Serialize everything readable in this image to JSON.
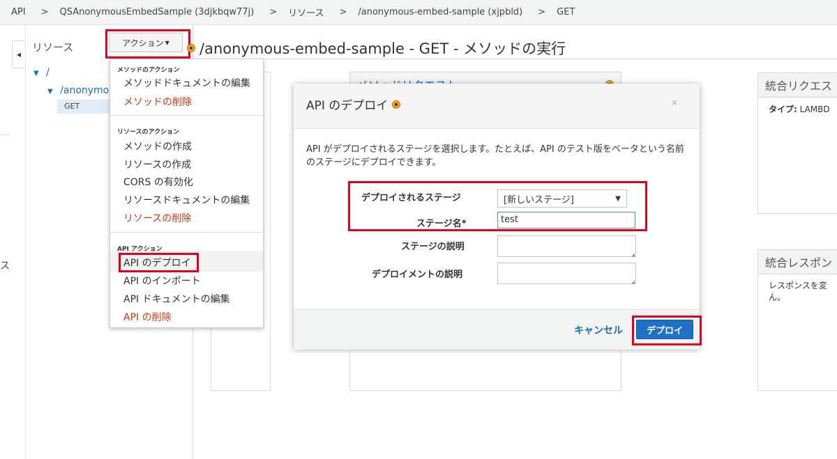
{
  "breadcrumb": [
    "API",
    "QSAnonymousEmbedSample (3djkbqw77j)",
    "リソース",
    "/anonymous-embed-sample (xjpbld)",
    "GET"
  ],
  "breadcrumb_separator": ">",
  "resources": {
    "title": "リソース",
    "actions_button": "アクション",
    "tree": {
      "root": "/",
      "child": "/anonymou",
      "method": "GET"
    }
  },
  "page_title": "/anonymous-embed-sample - GET - メソッドの実行",
  "left_strip_char": "ス",
  "background": {
    "method_request_title": "メソッドリクエスト",
    "integration_request_title": "統合リクエス",
    "integration_request_type_label": "タイプ:",
    "integration_request_type_value": "LAMBD",
    "integration_response_title": "統合レスポン",
    "integration_response_text": "レスポンスを変ん。"
  },
  "menu": {
    "sections": [
      {
        "header": "メソッドのアクション",
        "items": [
          {
            "label": "メソッドドキュメントの編集",
            "danger": false
          },
          {
            "label": "メソッドの削除",
            "danger": true
          }
        ]
      },
      {
        "header": "リソースのアクション",
        "items": [
          {
            "label": "メソッドの作成",
            "danger": false
          },
          {
            "label": "リソースの作成",
            "danger": false
          },
          {
            "label": "CORS の有効化",
            "danger": false
          },
          {
            "label": "リソースドキュメントの編集",
            "danger": false
          },
          {
            "label": "リソースの削除",
            "danger": true
          }
        ]
      },
      {
        "header": "API アクション",
        "items": [
          {
            "label": "API のデプロイ",
            "danger": false
          },
          {
            "label": "API のインポート",
            "danger": false
          },
          {
            "label": "API ドキュメントの編集",
            "danger": false
          },
          {
            "label": "API の削除",
            "danger": true
          }
        ]
      }
    ]
  },
  "modal": {
    "title": "API のデプロイ",
    "close": "×",
    "description": "API がデプロイされるステージを選択します。たとえば、API のテスト版をベータという名前のステージにデプロイできます。",
    "stage_label": "デプロイされるステージ",
    "stage_value": "[新しいステージ]",
    "stage_name_label": "ステージ名*",
    "stage_name_value": "test",
    "stage_desc_label": "ステージの説明",
    "deploy_desc_label": "デプロイメントの説明",
    "cancel": "キャンセル",
    "deploy": "デプロイ"
  },
  "colors": {
    "highlight_red": "#e3001f",
    "link_blue": "#1a6fb5",
    "danger": "#d13212",
    "primary": "#1f70c8"
  }
}
